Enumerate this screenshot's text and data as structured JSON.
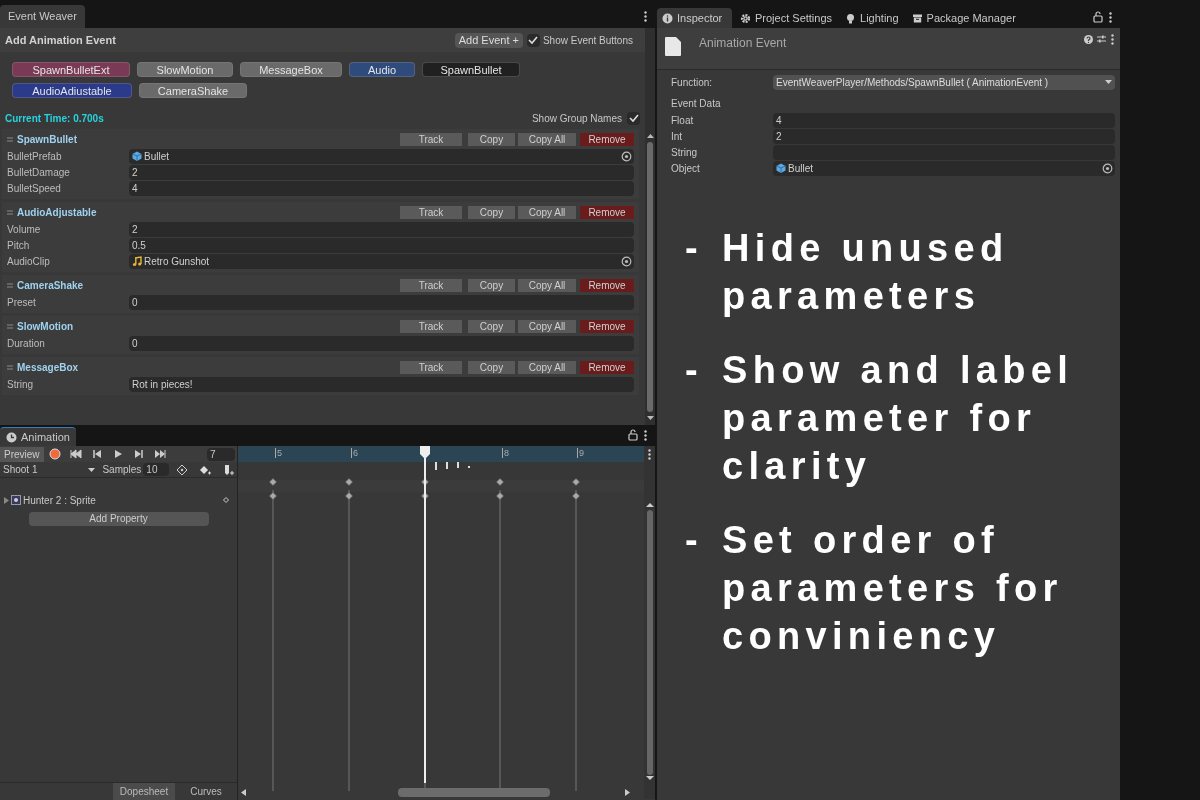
{
  "event_weaver": {
    "tab": "Event Weaver",
    "title": "Add Animation Event",
    "add_event_button": "Add Event +",
    "show_event_buttons": {
      "label": "Show Event Buttons",
      "checked": true
    },
    "event_buttons": [
      {
        "label": "SpawnBulletExt",
        "color": "#7a3a55"
      },
      {
        "label": "SlowMotion",
        "color": "#6a6a6a"
      },
      {
        "label": "MessageBox",
        "color": "#6a6a6a"
      },
      {
        "label": "Audio",
        "color": "#2f4b7c"
      },
      {
        "label": "SpawnBullet",
        "color": "#202020"
      },
      {
        "label": "AudioAdiustable",
        "color": "#2b3a8a"
      },
      {
        "label": "CameraShake",
        "color": "#6a6a6a"
      }
    ],
    "current_time": "Current Time: 0.700s",
    "show_group_names": {
      "label": "Show Group Names",
      "checked": true
    },
    "groups": [
      {
        "name": "SpawnBullet",
        "buttons": [
          "Track",
          "Copy",
          "Copy All",
          "Remove"
        ],
        "params": [
          {
            "label": "BulletPrefab",
            "value": "Bullet",
            "kind": "object"
          },
          {
            "label": "BulletDamage",
            "value": "2",
            "kind": "text"
          },
          {
            "label": "BulletSpeed",
            "value": "4",
            "kind": "text"
          }
        ]
      },
      {
        "name": "AudioAdjustable",
        "buttons": [
          "Track",
          "Copy",
          "Copy All",
          "Remove"
        ],
        "params": [
          {
            "label": "Volume",
            "value": "2",
            "kind": "text"
          },
          {
            "label": "Pitch",
            "value": "0.5",
            "kind": "text"
          },
          {
            "label": "AudioClip",
            "value": "Retro Gunshot",
            "kind": "audio"
          }
        ]
      },
      {
        "name": "CameraShake",
        "buttons": [
          "Track",
          "Copy",
          "Copy All",
          "Remove"
        ],
        "params": [
          {
            "label": "Preset",
            "value": "0",
            "kind": "text"
          }
        ]
      },
      {
        "name": "SlowMotion",
        "buttons": [
          "Track",
          "Copy",
          "Copy All",
          "Remove"
        ],
        "params": [
          {
            "label": "Duration",
            "value": "0",
            "kind": "text"
          }
        ]
      },
      {
        "name": "MessageBox",
        "buttons": [
          "Track",
          "Copy",
          "Copy All",
          "Remove"
        ],
        "params": [
          {
            "label": "String",
            "value": "Rot in pieces!",
            "kind": "text"
          }
        ]
      }
    ]
  },
  "animation": {
    "tab": "Animation",
    "preview_button": "Preview",
    "frame": "7",
    "clip": "Shoot 1",
    "samples_label": "Samples",
    "samples": "10",
    "ruler_labels": [
      "5",
      "6",
      "8",
      "9"
    ],
    "property": "Hunter 2 : Sprite",
    "add_property_button": "Add Property",
    "bottom_tabs": [
      {
        "label": "Dopesheet",
        "selected": true
      },
      {
        "label": "Curves",
        "selected": false
      }
    ]
  },
  "inspector": {
    "tabs": [
      {
        "label": "Inspector",
        "kind": "info",
        "selected": true
      },
      {
        "label": "Project Settings",
        "kind": "gear",
        "selected": false
      },
      {
        "label": "Lighting",
        "kind": "bulb",
        "selected": false
      },
      {
        "label": "Package Manager",
        "kind": "package",
        "selected": false
      }
    ],
    "title": "Animation Event",
    "function_label": "Function:",
    "function_value": "EventWeaverPlayer/Methods/SpawnBullet ( AnimationEvent )",
    "event_data": "Event Data",
    "fields": [
      {
        "label": "Float",
        "value": "4",
        "kind": "text"
      },
      {
        "label": "Int",
        "value": "2",
        "kind": "text"
      },
      {
        "label": "String",
        "kind": "text"
      },
      {
        "label": "Object",
        "value": "Bullet",
        "kind": "object"
      }
    ]
  },
  "notes": [
    {
      "bullet": "-",
      "text": "Hide unused parameters"
    },
    {
      "bullet": "-",
      "text": "Show and label parameter for clarity"
    },
    {
      "bullet": "-",
      "text": "Set order of parameters for conviniency"
    }
  ]
}
